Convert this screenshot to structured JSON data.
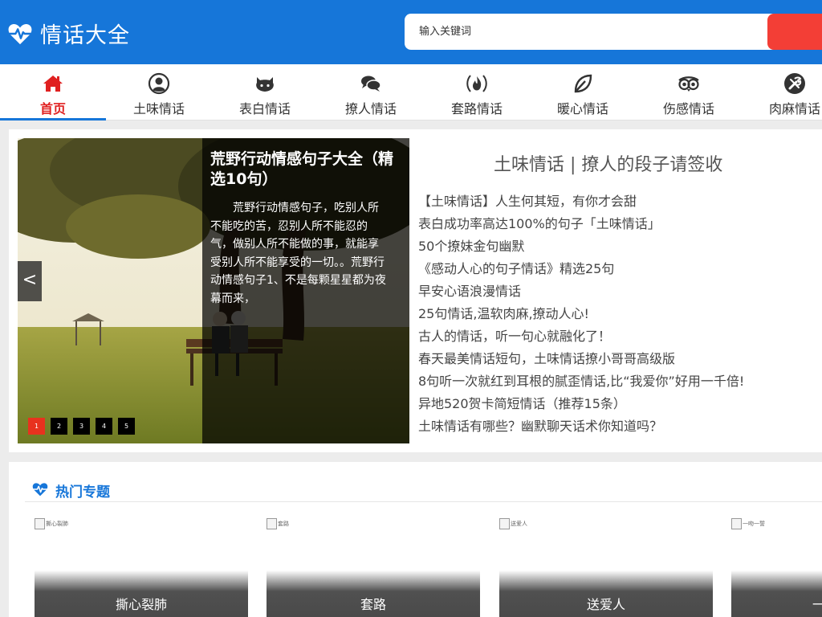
{
  "header": {
    "site_title": "情话大全",
    "logo_icon": "heartbeat-icon",
    "search": {
      "placeholder": "输入关键词"
    },
    "colors": {
      "primary": "#1676d9",
      "accent": "#f33e36"
    }
  },
  "nav": {
    "items": [
      {
        "label": "首页",
        "icon": "home-icon",
        "active": true
      },
      {
        "label": "土味情话",
        "icon": "user-icon"
      },
      {
        "label": "表白情话",
        "icon": "github-cat-icon"
      },
      {
        "label": "撩人情话",
        "icon": "chat-bubbles-icon"
      },
      {
        "label": "套路情话",
        "icon": "fire-icon"
      },
      {
        "label": "暖心情话",
        "icon": "leaf-icon"
      },
      {
        "label": "伤感情话",
        "icon": "tripadvisor-owl-icon"
      },
      {
        "label": "肉麻情话",
        "icon": "tools-icon"
      }
    ]
  },
  "slider": {
    "title": "荒野行动情感句子大全（精选10句）",
    "description": "荒野行动情感句子，吃别人所不能吃的苦，忍别人所不能忍的气，做别人所不能做的事，就能享受别人所不能享受的一切。。荒野行动情感句子1、不是每颗星星都为夜幕而来，",
    "prev_label": "<",
    "dots": [
      "1",
      "2",
      "3",
      "4",
      "5"
    ],
    "active_dot": 0
  },
  "featured": {
    "title": "土味情话 | 撩人的段子请签收",
    "links": [
      "【土味情话】人生何其短，有你才会甜",
      "表白成功率高达100%的句子「土味情话」",
      "50个撩妹金句幽默",
      "《感动人心的句子情话》精选25句",
      "早安心语浪漫情话",
      "25句情话,温软肉麻,撩动人心!",
      "古人的情话，听一句心就融化了！",
      "春天最美情话短句，土味情话撩小哥哥高级版",
      "8句听一次就红到耳根的腻歪情话,比“我爱你”好用一千倍!",
      "异地520贺卡简短情话（推荐15条）",
      "土味情话有哪些？幽默聊天话术你知道吗？"
    ]
  },
  "hot_topics": {
    "title": "热门专题",
    "icon": "heartbeat-icon",
    "cards": [
      {
        "alt": "撕心裂肺",
        "label": "撕心裂肺"
      },
      {
        "alt": "套路",
        "label": "套路"
      },
      {
        "alt": "送爱人",
        "label": "送爱人"
      },
      {
        "alt": "一吻一誓",
        "label": "一吻一誓"
      }
    ]
  }
}
